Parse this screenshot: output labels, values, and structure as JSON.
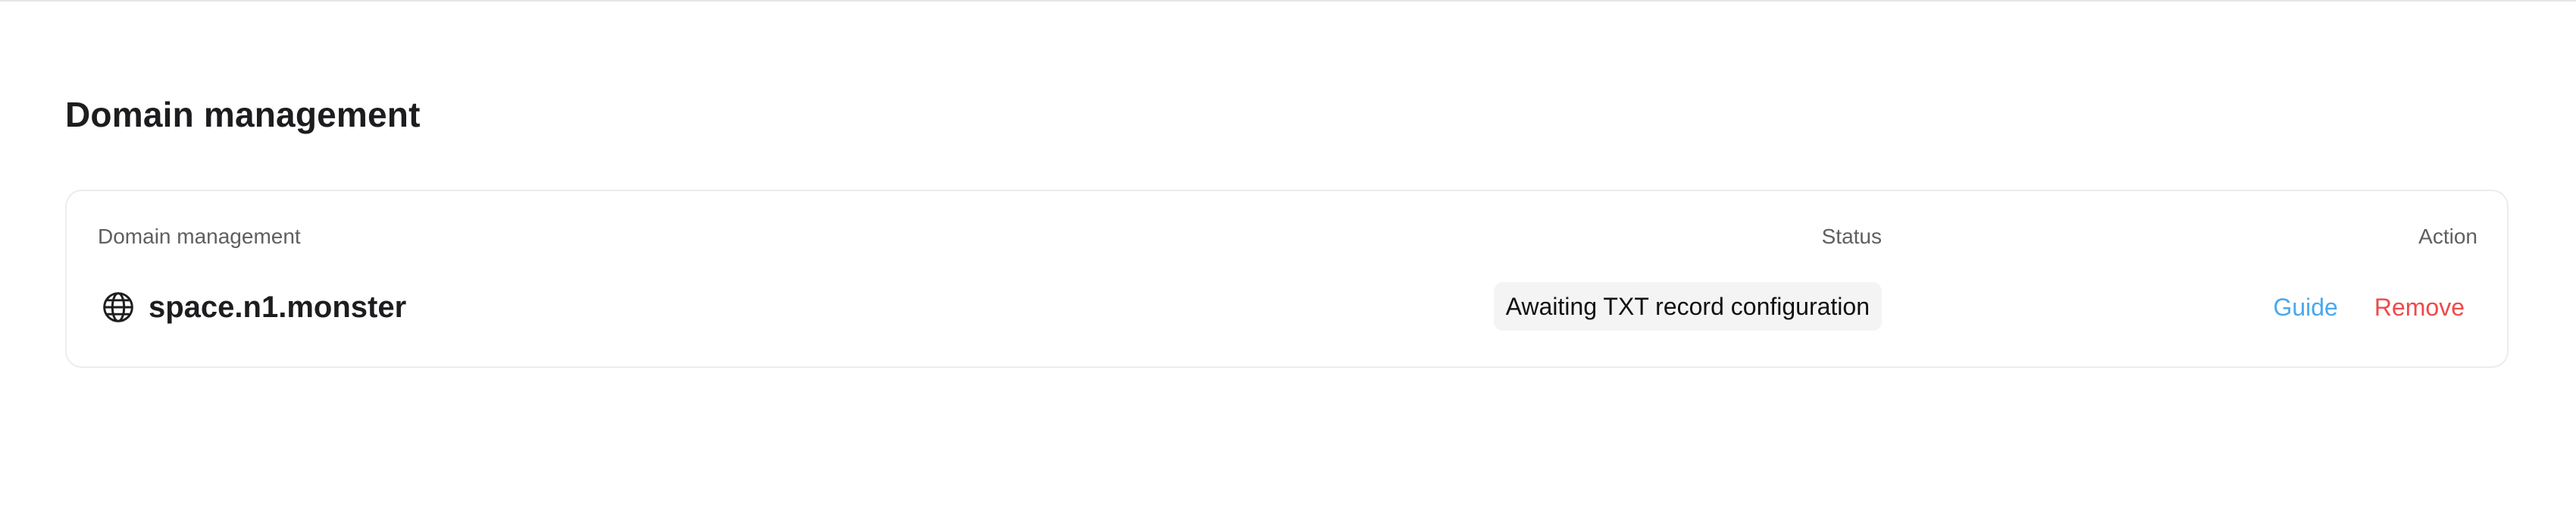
{
  "page": {
    "title": "Domain management"
  },
  "table": {
    "headers": {
      "domain": "Domain management",
      "status": "Status",
      "action": "Action"
    },
    "rows": [
      {
        "icon": "globe-icon",
        "domain": "space.n1.monster",
        "status": "Awaiting TXT record configuration",
        "guide_label": "Guide",
        "remove_label": "Remove"
      }
    ]
  },
  "colors": {
    "guide_link": "#4aa8ee",
    "remove_link": "#ee4a4a",
    "status_badge_bg": "#f4f4f4"
  }
}
